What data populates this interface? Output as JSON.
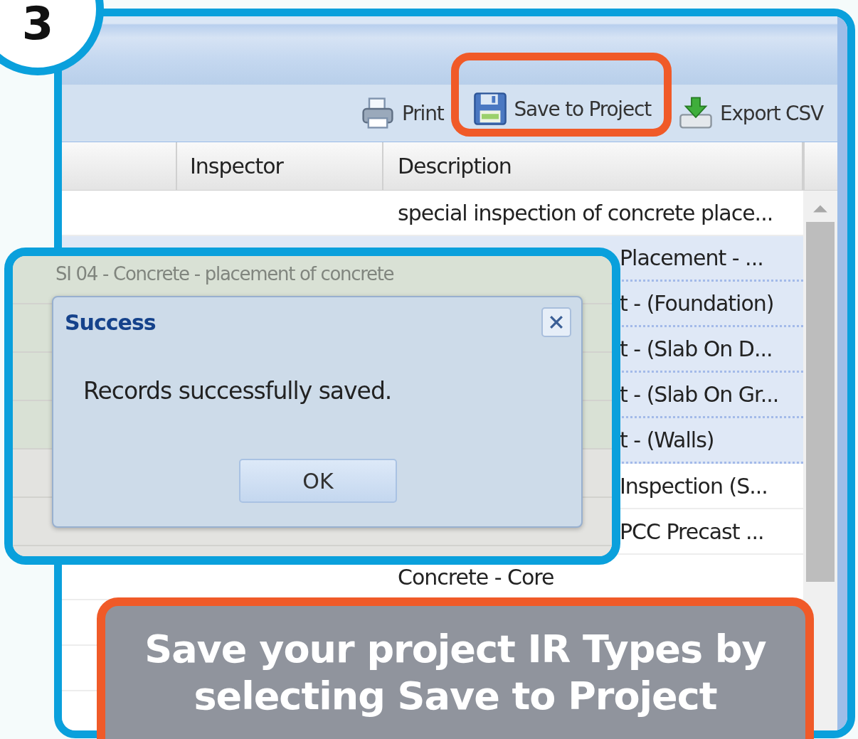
{
  "step_badge": "3",
  "toolbar": {
    "buttons": [
      {
        "label": "Print",
        "kind": "print",
        "highlighted": false
      },
      {
        "label": "Save to Project",
        "kind": "save",
        "highlighted": true
      },
      {
        "label": "Export CSV",
        "kind": "export",
        "highlighted": false
      }
    ]
  },
  "table": {
    "columns": [
      {
        "label": "Inspector"
      },
      {
        "label": "Description"
      }
    ],
    "rows": [
      {
        "description": "special inspection of concrete place...",
        "selected": false
      },
      {
        "description": "Placement - ...",
        "selected": true
      },
      {
        "description": "t - (Foundation)",
        "selected": true
      },
      {
        "description": "t - (Slab On D...",
        "selected": true
      },
      {
        "description": "t - (Slab On Gr...",
        "selected": true
      },
      {
        "description": "t - (Walls)",
        "selected": true
      },
      {
        "description": "Inspection (S...",
        "selected": false
      },
      {
        "description": "PCC Precast ...",
        "selected": false
      },
      {
        "description": "Concrete - Core",
        "selected": false
      }
    ]
  },
  "inset": {
    "background_text": "SI 04 - Concrete - placement of concrete",
    "dialog": {
      "title": "Success",
      "message": "Records successfully saved.",
      "button": "OK"
    }
  },
  "caption": {
    "lines": [
      "Save your project IR Types by",
      "selecting Save to Project"
    ]
  }
}
